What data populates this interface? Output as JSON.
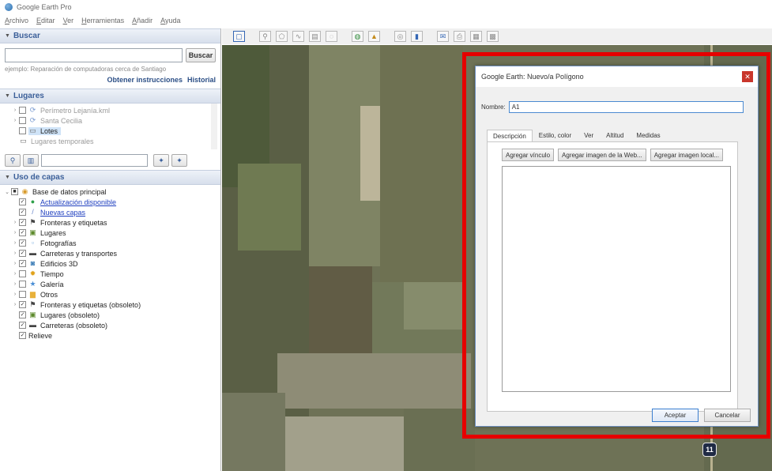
{
  "app": {
    "title": "Google Earth Pro"
  },
  "menu": [
    {
      "u": "A",
      "rest": "rchivo"
    },
    {
      "u": "E",
      "rest": "ditar"
    },
    {
      "u": "V",
      "rest": "er"
    },
    {
      "u": "H",
      "rest": "erramientas"
    },
    {
      "u": "A",
      "rest": "ñadir"
    },
    {
      "u": "A",
      "rest": "yuda"
    }
  ],
  "search": {
    "header": "Buscar",
    "button": "Buscar",
    "hint": "ejemplo: Reparación de computadoras cerca de Santiago",
    "directions_link": "Obtener instrucciones",
    "history_link": "Historial",
    "value": ""
  },
  "places": {
    "header": "Lugares",
    "items": [
      {
        "label": "Perímetro Lejanía.kml",
        "faded": true
      },
      {
        "label": "Santa Cecilia",
        "faded": true
      },
      {
        "label": "Lotes",
        "selected": true
      },
      {
        "label": "Lugares temporales",
        "faded": true
      }
    ]
  },
  "layers": {
    "header": "Uso de capas",
    "root": "Base de datos principal",
    "items": [
      {
        "label": "Actualización disponible",
        "link": true
      },
      {
        "label": "Nuevas capas",
        "link": true
      },
      {
        "label": "Fronteras y etiquetas"
      },
      {
        "label": "Lugares"
      },
      {
        "label": "Fotografías"
      },
      {
        "label": "Carreteras y transportes"
      },
      {
        "label": "Edificios 3D"
      },
      {
        "label": "Tiempo"
      },
      {
        "label": "Galería"
      },
      {
        "label": "Otros"
      },
      {
        "label": "Fronteras y etiquetas (obsoleto)"
      },
      {
        "label": "Lugares (obsoleto)"
      },
      {
        "label": "Carreteras (obsoleto)"
      },
      {
        "label": "Relieve"
      }
    ]
  },
  "dialog": {
    "title": "Google Earth: Nuevo/a Polígono",
    "name_label": "Nombre:",
    "name_value": "A1",
    "tabs": [
      "Descripción",
      "Estilo, color",
      "Ver",
      "Altitud",
      "Medidas"
    ],
    "buttons": [
      "Agregar vínculo",
      "Agregar imagen de la Web...",
      "Agregar imagen local..."
    ],
    "ok": "Aceptar",
    "cancel": "Cancelar",
    "description": ""
  },
  "map": {
    "road_sign": "11"
  },
  "colors": {
    "highlight": "#e60000",
    "link": "#1f3fbf",
    "panel_header_text": "#3b5f99"
  }
}
